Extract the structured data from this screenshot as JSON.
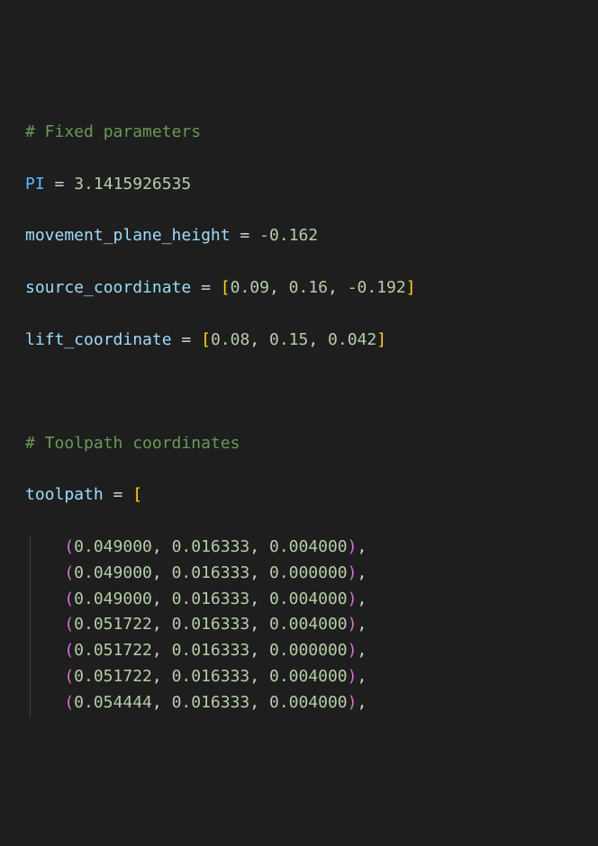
{
  "comments": {
    "fixed": "# Fixed parameters",
    "toolpath": "# Toolpath coordinates"
  },
  "assign": {
    "pi_name": "PI",
    "pi_val": "3.1415926535",
    "mph_name": "movement_plane_height",
    "mph_val": "-0.162",
    "src_name": "source_coordinate",
    "src_vals": [
      "0.09",
      "0.16",
      "-0.192"
    ],
    "lift_name": "lift_coordinate",
    "lift_vals": [
      "0.08",
      "0.15",
      "0.042"
    ],
    "tp_name": "toolpath"
  },
  "eq": "=",
  "lbr": "[",
  "rbr": "]",
  "lp": "(",
  "rp": ")",
  "comma": ",",
  "sep": ", ",
  "toolpath": [
    [
      "0.049000",
      "0.016333",
      "0.004000"
    ],
    [
      "0.049000",
      "0.016333",
      "0.000000"
    ],
    [
      "0.049000",
      "0.016333",
      "0.004000"
    ],
    [
      "0.051722",
      "0.016333",
      "0.004000"
    ],
    [
      "0.051722",
      "0.016333",
      "0.000000"
    ],
    [
      "0.051722",
      "0.016333",
      "0.004000"
    ],
    [
      "0.054444",
      "0.016333",
      "0.004000"
    ]
  ]
}
